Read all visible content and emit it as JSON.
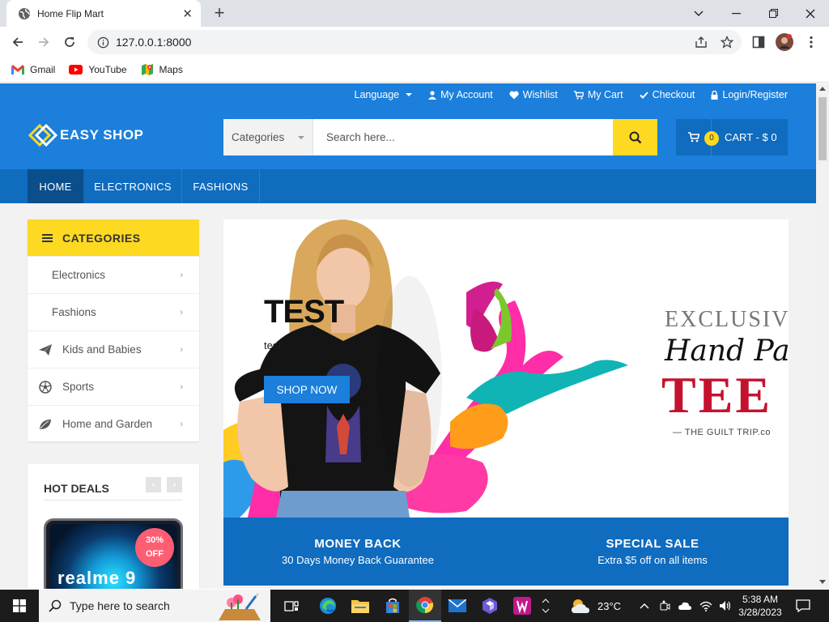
{
  "browser": {
    "tab_title": "Home Flip Mart",
    "url": "127.0.0.1:8000",
    "bookmarks": [
      {
        "label": "Gmail",
        "icon": "gmail-icon"
      },
      {
        "label": "YouTube",
        "icon": "youtube-icon"
      },
      {
        "label": "Maps",
        "icon": "maps-icon"
      }
    ]
  },
  "header": {
    "toplinks": {
      "language": "Language",
      "account": "My Account",
      "wishlist": "Wishlist",
      "cart": "My Cart",
      "checkout": "Checkout",
      "login": "Login/Register"
    },
    "logo": "EASY SHOP",
    "search": {
      "category": "Categories",
      "placeholder": "Search here..."
    },
    "cart": {
      "count": "0",
      "label": "CART - $ 0"
    }
  },
  "nav": [
    "HOME",
    "ELECTRONICS",
    "FASHIONS"
  ],
  "sidebar": {
    "title": "CATEGORIES",
    "items": [
      {
        "label": "Electronics",
        "icon": ""
      },
      {
        "label": "Fashions",
        "icon": ""
      },
      {
        "label": "Kids and Babies",
        "icon": "paper-plane-icon"
      },
      {
        "label": "Sports",
        "icon": "soccer-ball-icon"
      },
      {
        "label": "Home and Garden",
        "icon": "leaf-icon"
      }
    ]
  },
  "hotdeals": {
    "title": "HOT DEALS",
    "product_brand": "realme 9",
    "discount_pct": "30%",
    "discount_word": "OFF"
  },
  "hero": {
    "title": "TEST",
    "subtitle": "test",
    "button": "SHOP NOW",
    "ad_line1": "EXCLUSIV",
    "ad_line2": "Hand Paint",
    "ad_line3": "TEE",
    "ad_line4": "— THE GUILT TRIP.co"
  },
  "info": [
    {
      "title": "MONEY BACK",
      "sub": "30 Days Money Back Guarantee"
    },
    {
      "title": "SPECIAL SALE",
      "sub": "Extra $5 off on all items"
    }
  ],
  "taskbar": {
    "search_placeholder": "Type here to search",
    "weather": "23°C",
    "time": "5:38 AM",
    "date": "3/28/2023"
  }
}
